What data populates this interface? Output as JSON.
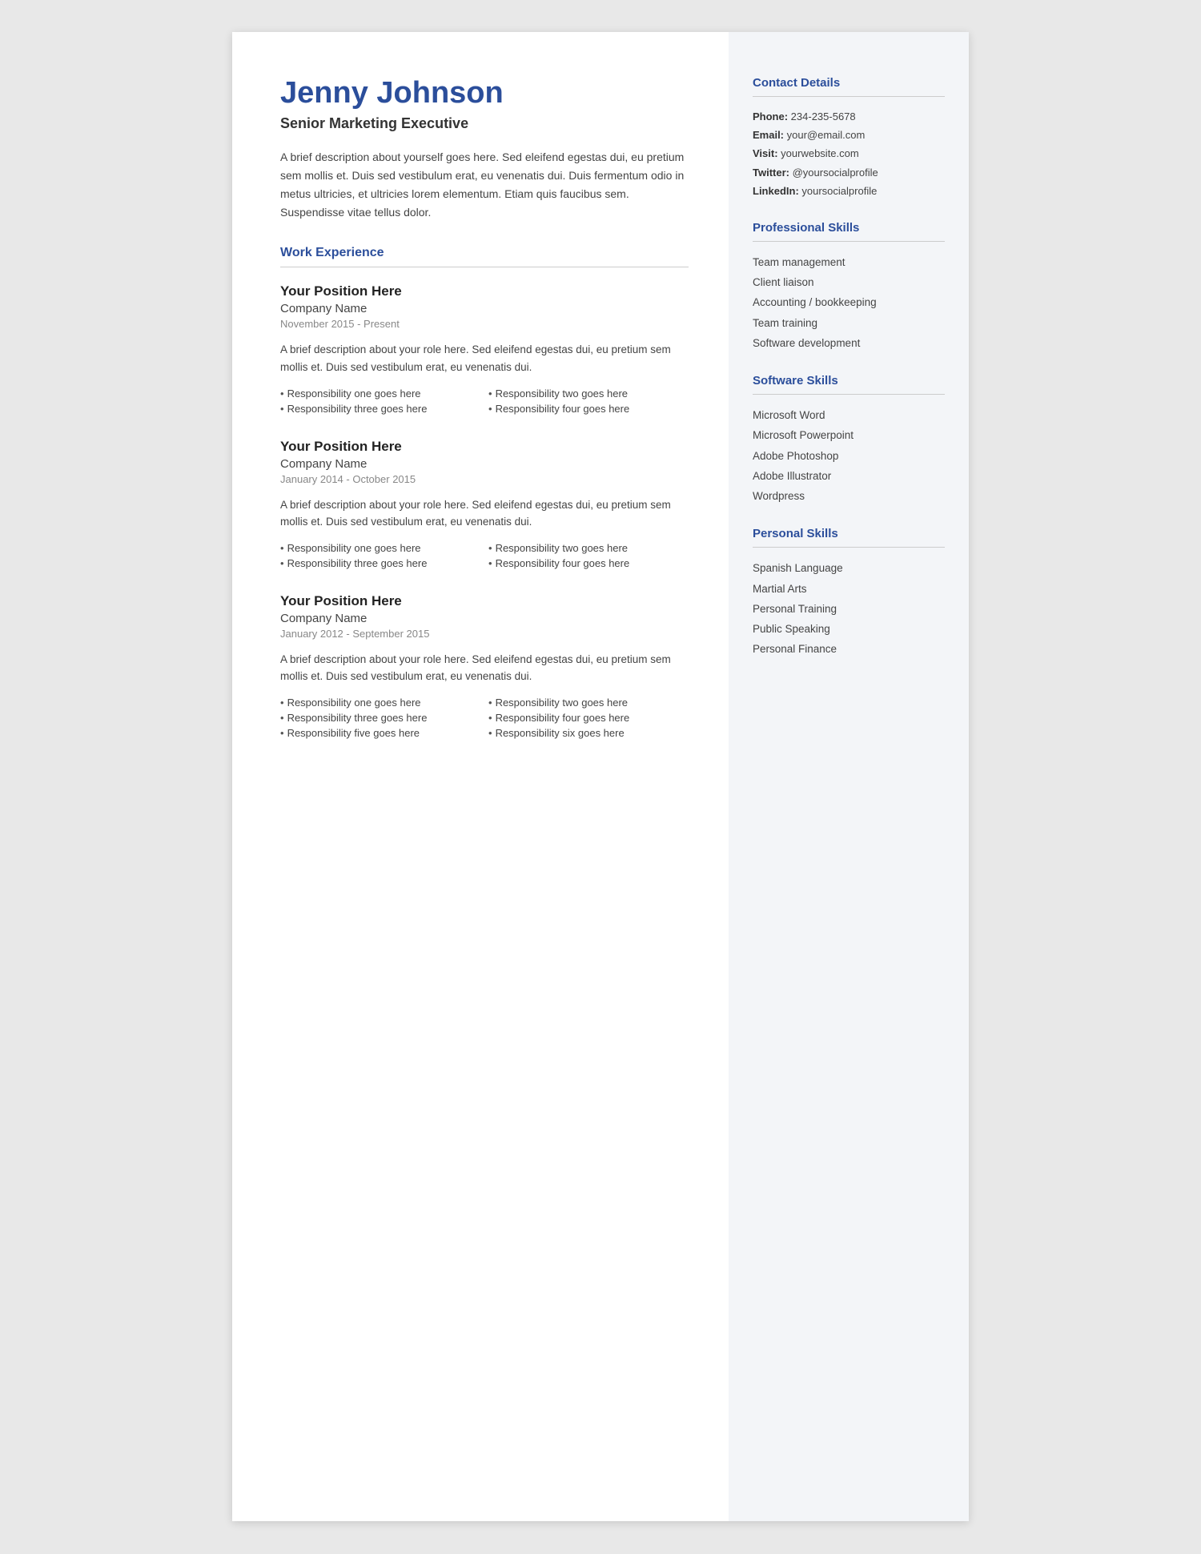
{
  "header": {
    "name": "Jenny Johnson",
    "title": "Senior Marketing Executive",
    "bio": "A brief description about yourself goes here. Sed eleifend egestas dui, eu pretium sem mollis et. Duis sed vestibulum erat, eu venenatis dui. Duis fermentum odio in metus ultricies, et ultricies lorem elementum. Etiam quis faucibus sem. Suspendisse vitae tellus dolor."
  },
  "work_experience": {
    "section_label": "Work Experience",
    "jobs": [
      {
        "position": "Your Position Here",
        "company": "Company Name",
        "dates": "November 2015 - Present",
        "description": "A brief description about your role here. Sed eleifend egestas dui, eu pretium sem mollis et. Duis sed vestibulum erat, eu venenatis dui.",
        "responsibilities": [
          "Responsibility one goes here",
          "Responsibility two goes here",
          "Responsibility three goes here",
          "Responsibility four goes here"
        ]
      },
      {
        "position": "Your Position Here",
        "company": "Company Name",
        "dates": "January 2014 - October 2015",
        "description": "A brief description about your role here. Sed eleifend egestas dui, eu pretium sem mollis et. Duis sed vestibulum erat, eu venenatis dui.",
        "responsibilities": [
          "Responsibility one goes here",
          "Responsibility two goes here",
          "Responsibility three goes here",
          "Responsibility four goes here"
        ]
      },
      {
        "position": "Your Position Here",
        "company": "Company Name",
        "dates": "January 2012 - September 2015",
        "description": "A brief description about your role here. Sed eleifend egestas dui, eu pretium sem mollis et. Duis sed vestibulum erat, eu venenatis dui.",
        "responsibilities": [
          "Responsibility one goes here",
          "Responsibility two goes here",
          "Responsibility three goes here",
          "Responsibility four goes here",
          "Responsibility five goes here",
          "Responsibility six goes here"
        ]
      }
    ]
  },
  "sidebar": {
    "contact": {
      "section_label": "Contact Details",
      "items": [
        {
          "label": "Phone:",
          "value": "234-235-5678"
        },
        {
          "label": "Email:",
          "value": "your@email.com"
        },
        {
          "label": "Visit:",
          "value": " yourwebsite.com"
        },
        {
          "label": "Twitter:",
          "value": "@yoursocialprofile"
        },
        {
          "label": "LinkedIn:",
          "value": "yoursocialprofile"
        }
      ]
    },
    "professional_skills": {
      "section_label": "Professional Skills",
      "items": [
        "Team management",
        "Client liaison",
        "Accounting / bookkeeping",
        "Team training",
        "Software development"
      ]
    },
    "software_skills": {
      "section_label": "Software Skills",
      "items": [
        "Microsoft Word",
        "Microsoft Powerpoint",
        "Adobe Photoshop",
        "Adobe Illustrator",
        "Wordpress"
      ]
    },
    "personal_skills": {
      "section_label": "Personal Skills",
      "items": [
        "Spanish Language",
        "Martial Arts",
        "Personal Training",
        "Public Speaking",
        "Personal Finance"
      ]
    }
  }
}
